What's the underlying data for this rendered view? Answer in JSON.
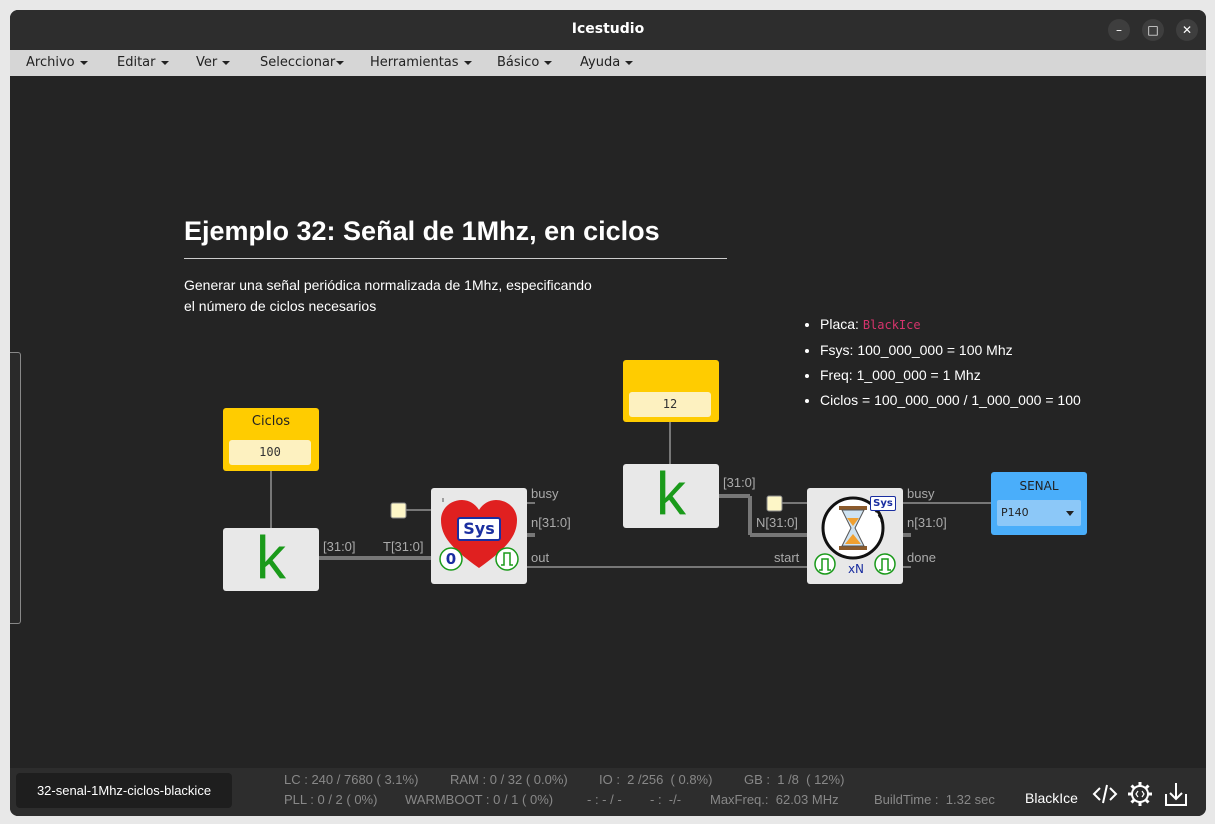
{
  "window": {
    "title": "Icestudio"
  },
  "menu": [
    {
      "label": "Archivo"
    },
    {
      "label": "Editar"
    },
    {
      "label": "Ver"
    },
    {
      "label": "Seleccionar"
    },
    {
      "label": "Herramientas"
    },
    {
      "label": "Básico"
    },
    {
      "label": "Ayuda"
    }
  ],
  "doc": {
    "heading": "Ejemplo 32: Señal de 1Mhz, en ciclos",
    "description_line1": "Generar una señal periódica normalizada de 1Mhz, especificando",
    "description_line2": "el número de ciclos necesarios",
    "bullets": {
      "placa_label": "Placa:",
      "placa_value": "BlackIce",
      "fsys": "Fsys: 100_000_000 = 100 Mhz",
      "freq": "Freq: 1_000_000 = 1 Mhz",
      "ciclos": "Ciclos = 100_000_000 / 1_000_000 = 100"
    }
  },
  "circuit": {
    "const1": {
      "name": "Ciclos",
      "value": "100"
    },
    "const2": {
      "name": "",
      "value": "12"
    },
    "k_label": "k",
    "heart_sys_label": "Sys",
    "heart_zero_label": "0",
    "timer_sys_label": "Sys",
    "timer_xn_label": "xN",
    "wire_labels": {
      "w1": "[31:0]",
      "w2": "T[31:0]",
      "w3": "[31:0]",
      "w4": "N[31:0]"
    },
    "heart_ports": {
      "busy": "busy",
      "n": "n[31:0]",
      "out": "out"
    },
    "timer_ports": {
      "start": "start",
      "busy": "busy",
      "n": "n[31:0]",
      "done": "done"
    },
    "output": {
      "name": "SENAL",
      "pin": "P140"
    }
  },
  "status": {
    "project": "32-senal-1Mhz-ciclos-blackice",
    "lc": "LC : 240 / 7680 ( 3.1%)",
    "ram": "RAM : 0 / 32 ( 0.0%)",
    "io": "IO :  2 /256  ( 0.8%)",
    "gb": "GB :  1 /8  ( 12%)",
    "pll": "PLL : 0 / 2 ( 0%)",
    "warmboot": "WARMBOOT : 0 / 1 ( 0%)",
    "x1": "- : - / -",
    "x2": "- :  -/-",
    "maxfreq": "MaxFreq.:  62.03 MHz",
    "buildtime": "BuildTime :  1.32 sec",
    "board": "BlackIce"
  },
  "colors": {
    "accent_const": "#ffcc00",
    "output_block": "#4aaefa",
    "k_green": "#1a9a1a",
    "heart_red": "#e02020"
  }
}
